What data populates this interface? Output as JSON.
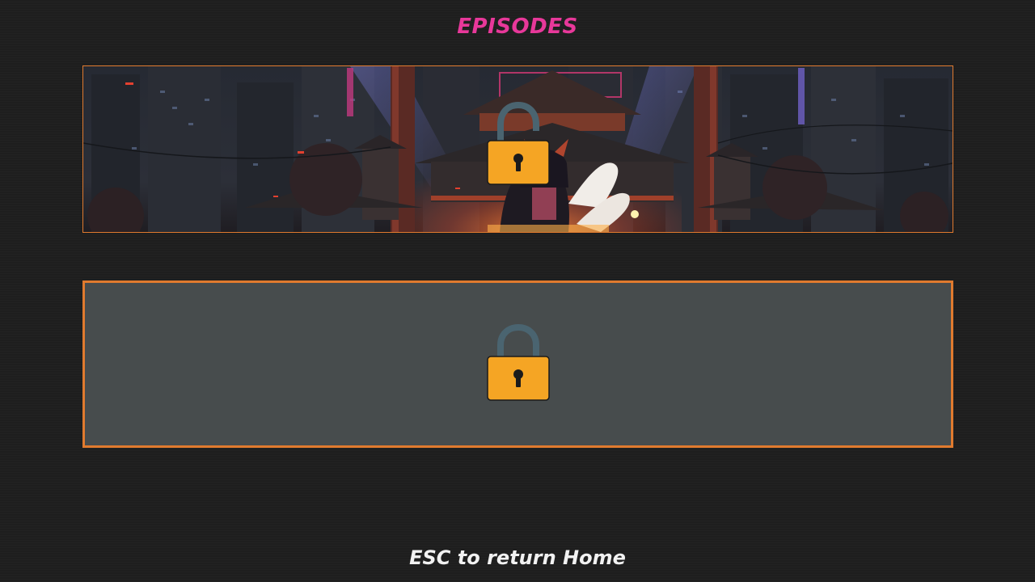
{
  "header": {
    "title": "EPISODES",
    "title_color": "#e8389a"
  },
  "episodes": [
    {
      "state": "unlocked",
      "lock_icon": "lock-open-icon",
      "artwork": "shrine-night-city-scene"
    },
    {
      "state": "locked",
      "lock_icon": "lock-closed-icon",
      "artwork": "none"
    }
  ],
  "footer": {
    "hint": "ESC to return Home",
    "hint_color": "#f2f2f2"
  },
  "colors": {
    "card_border": "#e07a2e",
    "locked_card_bg": "#474c4d",
    "lock_body": "#f5a524",
    "lock_shackle": "#4a6470",
    "page_bg": "#1e1e1e"
  }
}
